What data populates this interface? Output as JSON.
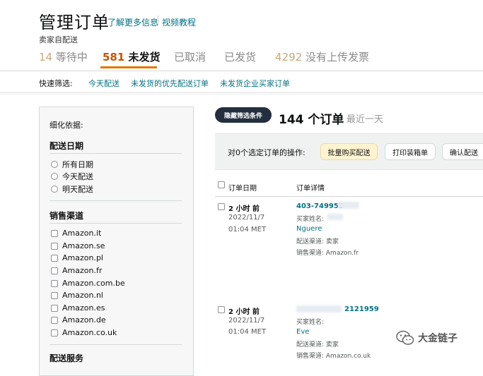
{
  "header": {
    "title": "管理订单",
    "learn_more": "了解更多信息",
    "video_tutorial": "视频教程",
    "subtitle": "卖家自配送"
  },
  "tabs": [
    {
      "count": "14",
      "label": "等待中"
    },
    {
      "count": "581",
      "label": "未发货"
    },
    {
      "count": "",
      "label": "已取消"
    },
    {
      "count": "",
      "label": "已发货"
    },
    {
      "count": "4292",
      "label": "没有上传发票"
    }
  ],
  "quick_filter": {
    "label": "快速筛选:",
    "items": [
      "今天配送",
      "未发货的优先配送订单",
      "未发货企业买家订单"
    ]
  },
  "filter_panel": {
    "refine_label": "细化依据:",
    "ship_date_heading": "配送日期",
    "ship_date_options": [
      "所有日期",
      "今天配送",
      "明天配送"
    ],
    "channel_heading": "销售渠道",
    "channels": [
      "Amazon.it",
      "Amazon.se",
      "Amazon.pl",
      "Amazon.fr",
      "Amazon.com.be",
      "Amazon.nl",
      "Amazon.es",
      "Amazon.de",
      "Amazon.co.uk"
    ],
    "next_heading": "配送服务"
  },
  "main": {
    "hide_filters_button": "隐藏筛选条件",
    "order_count": "144 个订单",
    "range": "最近一天",
    "bulk_label": "对0个选定订单的操作:",
    "buttons": {
      "bulk_buy_shipping": "批量购买配送",
      "print_packing_slip": "打印装箱单",
      "confirm_shipment": "确认配送"
    },
    "columns": {
      "order_date": "订单日期",
      "order_details": "订单详情"
    }
  },
  "orders": [
    {
      "time": "2 小时 前",
      "date": "2022/11/7",
      "clock": "01:04 MET",
      "order_id": "403-749955",
      "buyer_label": "买家姓名:",
      "buyer": "Nguere",
      "fulfillment": "配送渠道: 卖家",
      "channel": "销售渠道: Amazon.fr"
    },
    {
      "time": "2 小时 前",
      "date": "2022/11/7",
      "clock": "01:04 MET",
      "order_id": "2121959",
      "buyer_label": "买家姓名:",
      "buyer": "Eve",
      "fulfillment": "配送渠道: 卖家",
      "channel": "销售渠道: Amazon.co.uk"
    }
  ],
  "watermark": {
    "text": "大金链子",
    "icon": "wechat-icon"
  }
}
